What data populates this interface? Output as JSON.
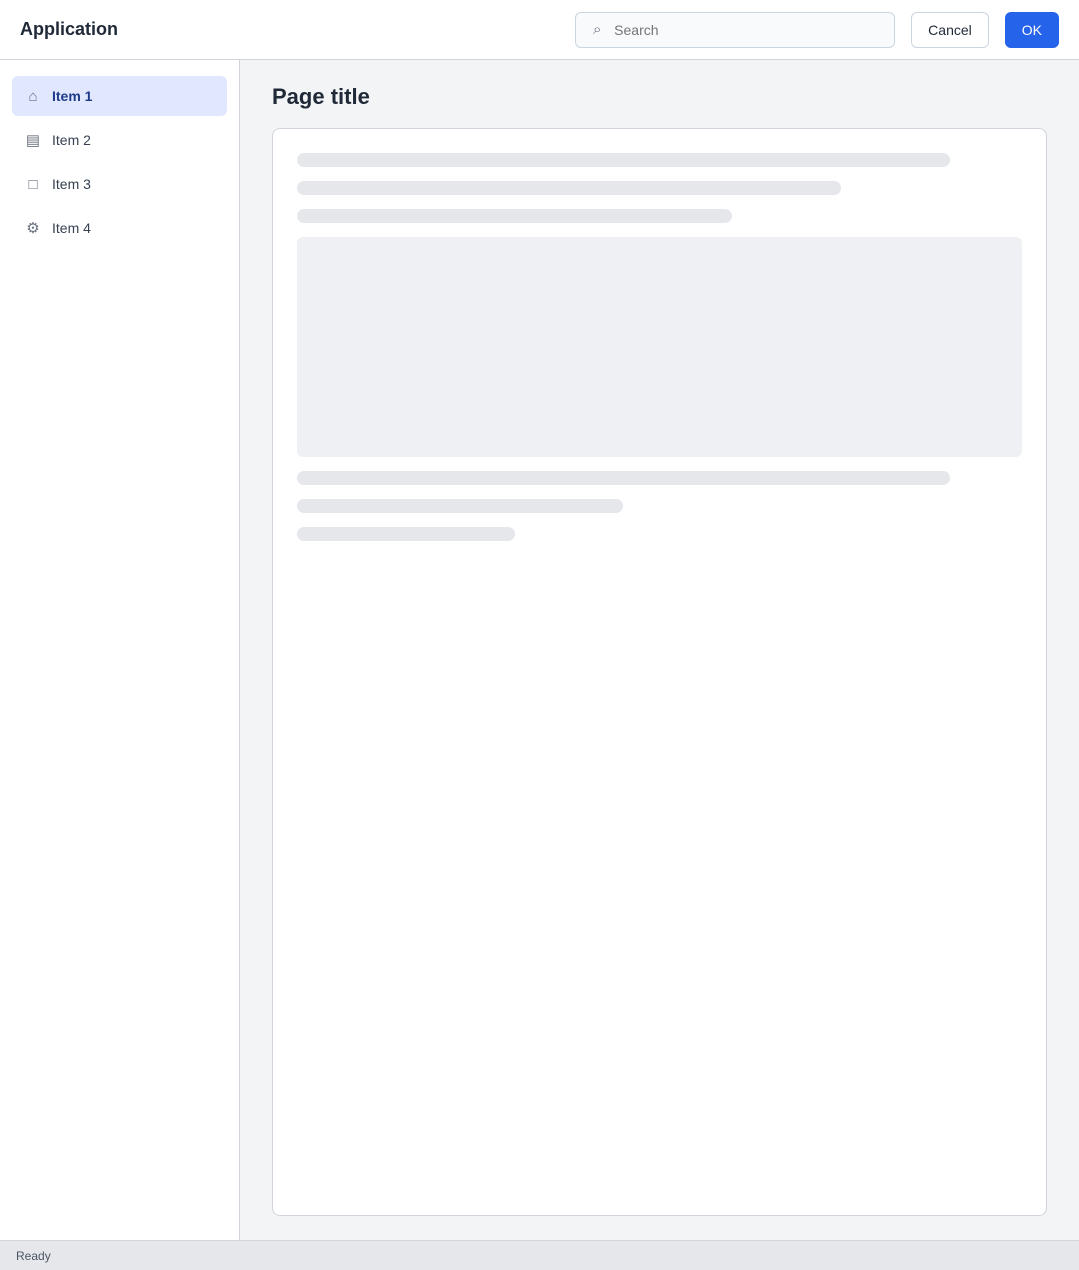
{
  "window": {
    "title": "Application"
  },
  "search": {
    "placeholder": "Search"
  },
  "toolbar": {
    "secondary_label": "Cancel",
    "primary_label": "OK"
  },
  "sidebar": {
    "items": [
      {
        "label": "Item 1",
        "icon": "home-icon"
      },
      {
        "label": "Item 2",
        "icon": "folder-icon"
      },
      {
        "label": "Item 3",
        "icon": "document-icon"
      },
      {
        "label": "Item 4",
        "icon": "settings-icon"
      }
    ]
  },
  "main": {
    "title": "Page title"
  },
  "status": {
    "text": "Ready"
  }
}
